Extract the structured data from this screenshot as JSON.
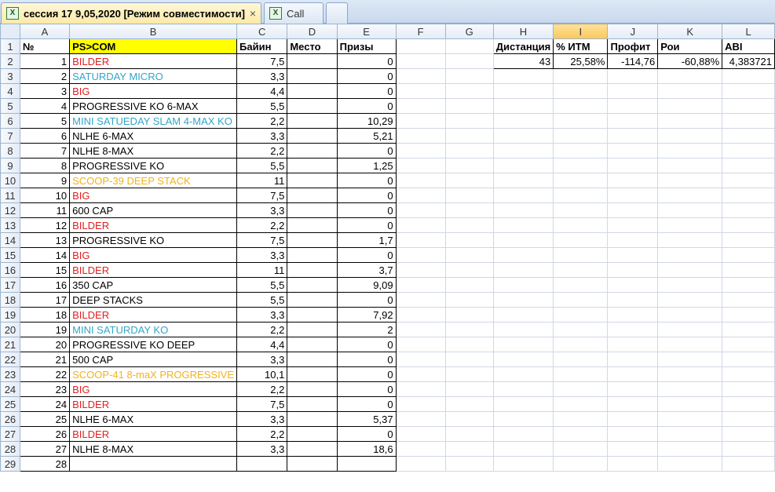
{
  "tabs": {
    "active_title": "сессия 17 9,05,2020  [Режим совместимости]",
    "close_glyph": "×",
    "second_title": "Call"
  },
  "columns": [
    "A",
    "B",
    "C",
    "D",
    "E",
    "F",
    "G",
    "H",
    "I",
    "J",
    "K",
    "L"
  ],
  "selected_column": "I",
  "colors": {
    "red": "#e02020",
    "blue": "#31a6c8",
    "orange": "#f2b21b",
    "header_yellow": "#ffff00"
  },
  "header_row": {
    "A": "№",
    "B": "PS>COM",
    "C": "Байин",
    "D": "Место",
    "E": "Призы"
  },
  "stats": {
    "headers": {
      "H": "Дистанция",
      "I": "% ИТМ",
      "J": "Профит",
      "K": "Рои",
      "L": "ABI"
    },
    "values": {
      "H": "43",
      "I": "25,58%",
      "J": "-114,76",
      "K": "-60,88%",
      "L": "4,383721"
    }
  },
  "rows": [
    {
      "n": "1",
      "name": "BILDER",
      "color": "red",
      "buyin": "7,5",
      "place": "",
      "prize": "0"
    },
    {
      "n": "2",
      "name": "SATURDAY MICRO",
      "color": "blue",
      "buyin": "3,3",
      "place": "",
      "prize": "0"
    },
    {
      "n": "3",
      "name": "BIG",
      "color": "red",
      "buyin": "4,4",
      "place": "",
      "prize": "0"
    },
    {
      "n": "4",
      "name": "PROGRESSIVE KO 6-MAX",
      "color": "black",
      "buyin": "5,5",
      "place": "",
      "prize": "0"
    },
    {
      "n": "5",
      "name": "MINI SATUEDAY SLAM 4-MAX KO",
      "color": "blue",
      "buyin": "2,2",
      "place": "",
      "prize": "10,29"
    },
    {
      "n": "6",
      "name": "NLHE 6-MAX",
      "color": "black",
      "buyin": "3,3",
      "place": "",
      "prize": "5,21"
    },
    {
      "n": "7",
      "name": "NLHE 8-MAX",
      "color": "black",
      "buyin": "2,2",
      "place": "",
      "prize": "0"
    },
    {
      "n": "8",
      "name": "PROGRESSIVE KO",
      "color": "black",
      "buyin": "5,5",
      "place": "",
      "prize": "1,25"
    },
    {
      "n": "9",
      "name": "SCOOP-39 DEEP STACK",
      "color": "orange",
      "buyin": "11",
      "place": "",
      "prize": "0"
    },
    {
      "n": "10",
      "name": "BIG",
      "color": "red",
      "buyin": "7,5",
      "place": "",
      "prize": "0"
    },
    {
      "n": "11",
      "name": "600 CAP",
      "color": "black",
      "buyin": "3,3",
      "place": "",
      "prize": "0"
    },
    {
      "n": "12",
      "name": "BILDER",
      "color": "red",
      "buyin": "2,2",
      "place": "",
      "prize": "0"
    },
    {
      "n": "13",
      "name": "PROGRESSIVE KO",
      "color": "black",
      "buyin": "7,5",
      "place": "",
      "prize": "1,7"
    },
    {
      "n": "14",
      "name": "BIG",
      "color": "red",
      "buyin": "3,3",
      "place": "",
      "prize": "0"
    },
    {
      "n": "15",
      "name": "BILDER",
      "color": "red",
      "buyin": "11",
      "place": "",
      "prize": "3,7"
    },
    {
      "n": "16",
      "name": "350 CAP",
      "color": "black",
      "buyin": "5,5",
      "place": "",
      "prize": "9,09"
    },
    {
      "n": "17",
      "name": "DEEP STACKS",
      "color": "black",
      "buyin": "5,5",
      "place": "",
      "prize": "0"
    },
    {
      "n": "18",
      "name": "BILDER",
      "color": "red",
      "buyin": "3,3",
      "place": "",
      "prize": "7,92"
    },
    {
      "n": "19",
      "name": "MINI SATURDAY KO",
      "color": "blue",
      "buyin": "2,2",
      "place": "",
      "prize": "2"
    },
    {
      "n": "20",
      "name": "PROGRESSIVE KO DEEP",
      "color": "black",
      "buyin": "4,4",
      "place": "",
      "prize": "0"
    },
    {
      "n": "21",
      "name": "500 CAP",
      "color": "black",
      "buyin": "3,3",
      "place": "",
      "prize": "0"
    },
    {
      "n": "22",
      "name": "SCOOP-41 8-maX PROGRESSIVE",
      "color": "orange",
      "buyin": "10,1",
      "place": "",
      "prize": "0"
    },
    {
      "n": "23",
      "name": "BIG",
      "color": "red",
      "buyin": "2,2",
      "place": "",
      "prize": "0"
    },
    {
      "n": "24",
      "name": "BILDER",
      "color": "red",
      "buyin": "7,5",
      "place": "",
      "prize": "0"
    },
    {
      "n": "25",
      "name": "NLHE 6-MAX",
      "color": "black",
      "buyin": "3,3",
      "place": "",
      "prize": "5,37"
    },
    {
      "n": "26",
      "name": "BILDER",
      "color": "red",
      "buyin": "2,2",
      "place": "",
      "prize": "0"
    },
    {
      "n": "27",
      "name": "NLHE 8-MAX",
      "color": "black",
      "buyin": "3,3",
      "place": "",
      "prize": "18,6"
    },
    {
      "n": "28",
      "name": "",
      "color": "black",
      "buyin": "",
      "place": "",
      "prize": ""
    }
  ]
}
